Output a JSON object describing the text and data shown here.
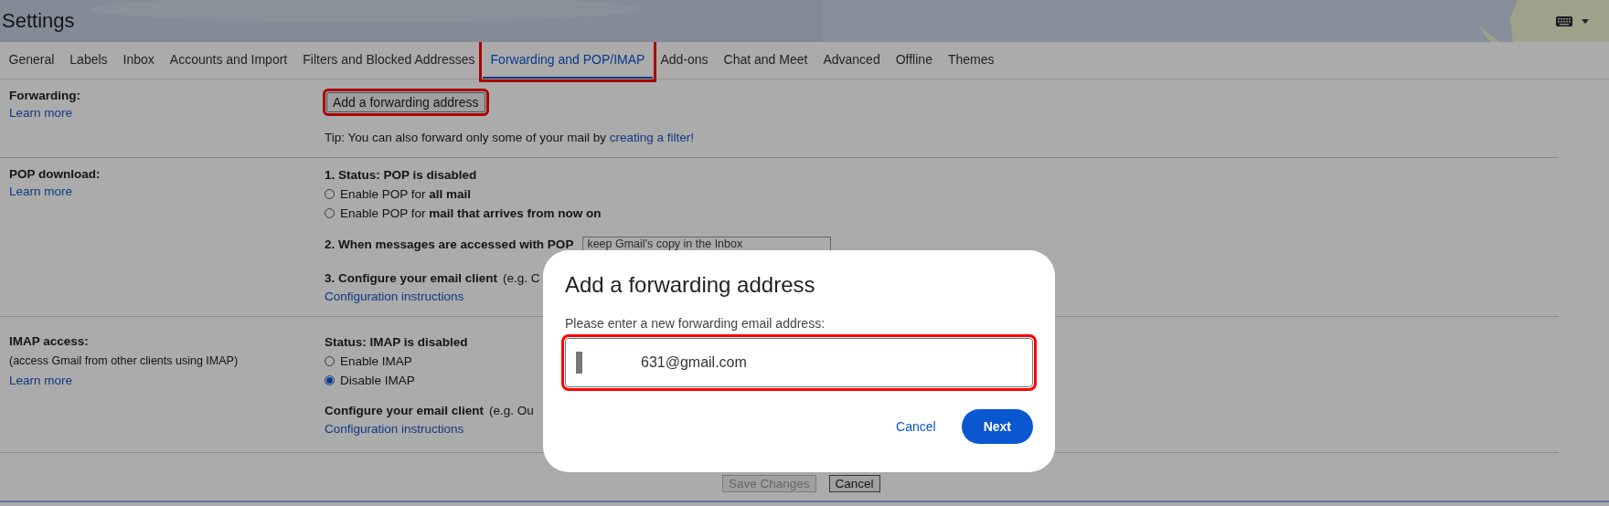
{
  "header": {
    "title": "Settings"
  },
  "tabs": [
    {
      "label": "General",
      "selected": false,
      "highlighted": false
    },
    {
      "label": "Labels",
      "selected": false,
      "highlighted": false
    },
    {
      "label": "Inbox",
      "selected": false,
      "highlighted": false
    },
    {
      "label": "Accounts and Import",
      "selected": false,
      "highlighted": false
    },
    {
      "label": "Filters and Blocked Addresses",
      "selected": false,
      "highlighted": false
    },
    {
      "label": "Forwarding and POP/IMAP",
      "selected": true,
      "highlighted": true
    },
    {
      "label": "Add-ons",
      "selected": false,
      "highlighted": false
    },
    {
      "label": "Chat and Meet",
      "selected": false,
      "highlighted": false
    },
    {
      "label": "Advanced",
      "selected": false,
      "highlighted": false
    },
    {
      "label": "Offline",
      "selected": false,
      "highlighted": false
    },
    {
      "label": "Themes",
      "selected": false,
      "highlighted": false
    }
  ],
  "forwarding": {
    "label": "Forwarding:",
    "learn_more": "Learn more",
    "add_button": {
      "label": "Add a forwarding address",
      "highlighted": true
    },
    "tip": "Tip: You can also forward only some of your mail by ",
    "tip_link": "creating a filter!"
  },
  "pop": {
    "label": "POP download:",
    "learn_more": "Learn more",
    "status": "1. Status: POP is disabled",
    "options": [
      {
        "label": "Enable POP for **all mail**",
        "selected": false
      },
      {
        "label": "Enable POP for **mail that arrives from now on**",
        "selected": false
      }
    ],
    "access_label": "2. When messages are accessed with POP",
    "access_select": "keep Gmail's copy in the Inbox",
    "configure": "**3. Configure your email client** (e.g. C",
    "configure_link": "Configuration instructions"
  },
  "imap": {
    "label": "IMAP access:",
    "note": "(access Gmail from other clients using IMAP)",
    "learn_more": "Learn more",
    "status": "Status: IMAP is disabled",
    "options": [
      {
        "label": "Enable IMAP",
        "selected": false
      },
      {
        "label": "Disable IMAP",
        "selected": true
      }
    ],
    "configure": "**Configure your email client** (e.g. Ou",
    "configure_link": "Configuration instructions"
  },
  "footer_buttons": [
    {
      "label": "Save Changes",
      "disabled": true
    },
    {
      "label": "Cancel",
      "disabled": false
    }
  ],
  "dialog": {
    "title": "Add a forwarding address",
    "prompt": "Please enter a new forwarding email address:",
    "value": "631@gmail.com",
    "value_highlighted": true,
    "buttons": [
      {
        "label": "Cancel",
        "kind": "text"
      },
      {
        "label": "Next",
        "kind": "primary"
      }
    ]
  }
}
